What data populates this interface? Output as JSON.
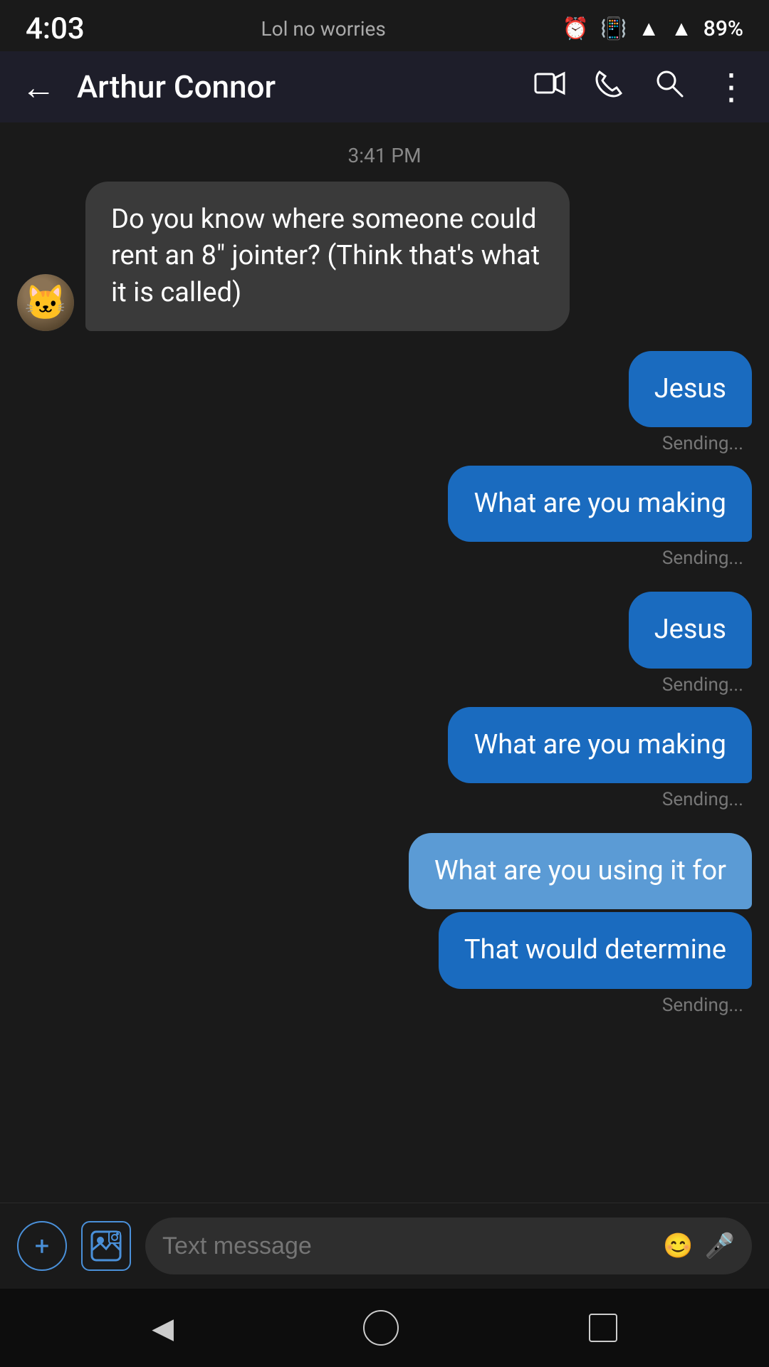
{
  "statusBar": {
    "time": "4:03",
    "notification": "Lol no worries",
    "battery": "89%"
  },
  "toolbar": {
    "contactName": "Arthur Connor",
    "backIcon": "←",
    "videoIcon": "▭",
    "phoneIcon": "✆",
    "searchIcon": "🔍",
    "moreIcon": "⋮"
  },
  "chat": {
    "timestamp": "3:41 PM",
    "messages": [
      {
        "id": "msg1",
        "type": "received",
        "text": "Do you know where someone could rent an 8\" jointer? (Think that's what it is called)",
        "hasAvatar": true
      },
      {
        "id": "msg2",
        "type": "sent",
        "text": "Jesus",
        "status": "Sending..."
      },
      {
        "id": "msg3",
        "type": "sent",
        "text": "What are you making",
        "status": "Sending..."
      },
      {
        "id": "msg4",
        "type": "sent",
        "text": "Jesus",
        "status": "Sending..."
      },
      {
        "id": "msg5",
        "type": "sent",
        "text": "What are you making",
        "status": "Sending..."
      },
      {
        "id": "msg6",
        "type": "sent",
        "text": "What are you using it for",
        "lighter": true
      },
      {
        "id": "msg7",
        "type": "sent",
        "text": "That would determine",
        "status": "Sending...",
        "lighter": false
      }
    ]
  },
  "inputBar": {
    "placeholder": "Text message",
    "addIcon": "+",
    "mediaIcon": "🖼",
    "emojiIcon": "😊",
    "micIcon": "🎤"
  },
  "navBar": {
    "backIcon": "◀"
  }
}
